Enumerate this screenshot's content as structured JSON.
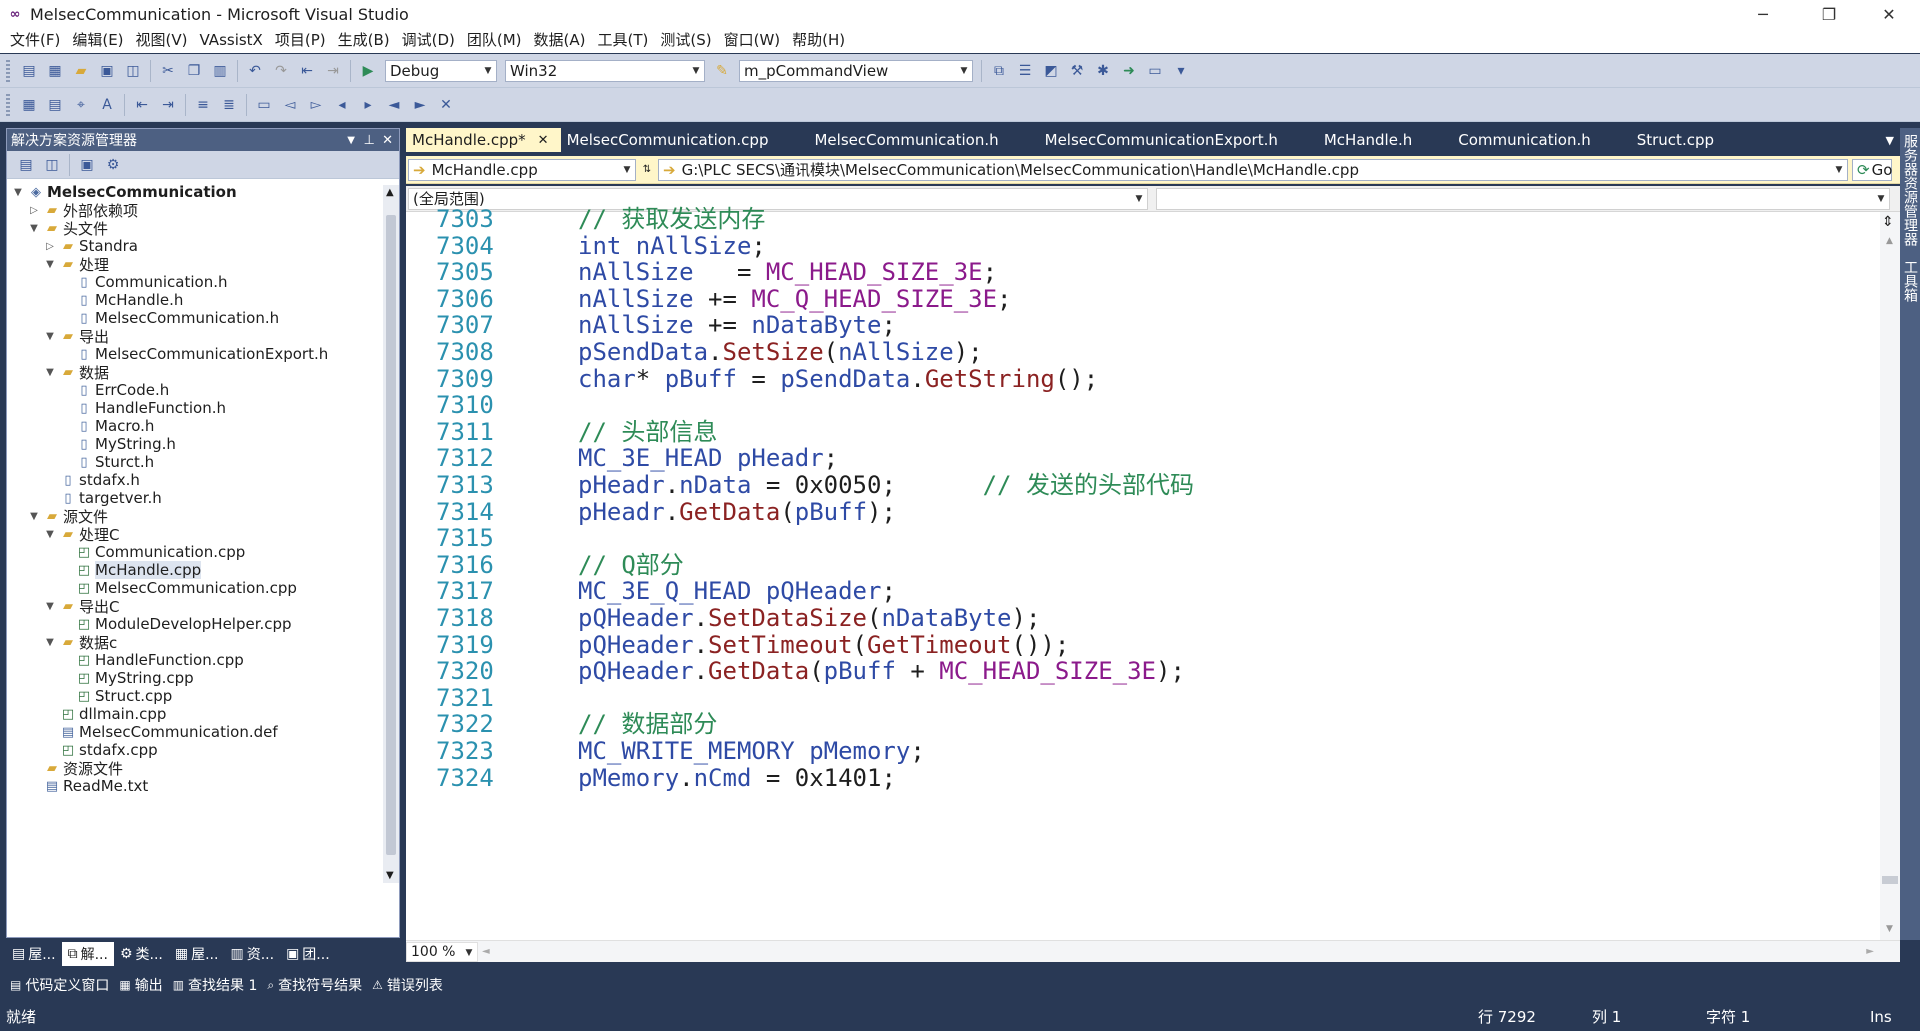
{
  "window": {
    "title": "MelsecCommunication - Microsoft Visual Studio",
    "minimize": "─",
    "maximize": "❐",
    "close": "✕"
  },
  "menu": [
    "文件(F)",
    "编辑(E)",
    "视图(V)",
    "VAssistX",
    "项目(P)",
    "生成(B)",
    "调试(D)",
    "团队(M)",
    "数据(A)",
    "工具(T)",
    "测试(S)",
    "窗口(W)",
    "帮助(H)"
  ],
  "toolbar": {
    "config": "Debug",
    "platform": "Win32",
    "find": "m_pCommandView"
  },
  "solution_explorer": {
    "title": "解决方案资源管理器",
    "tree": [
      {
        "label": "MelsecCommunication",
        "depth": 0,
        "exp": "▼",
        "icon": "solution",
        "bold": true
      },
      {
        "label": "外部依赖项",
        "depth": 1,
        "exp": "▷",
        "icon": "folder"
      },
      {
        "label": "头文件",
        "depth": 1,
        "exp": "▼",
        "icon": "folder"
      },
      {
        "label": "Standra",
        "depth": 2,
        "exp": "▷",
        "icon": "folder"
      },
      {
        "label": "处理",
        "depth": 2,
        "exp": "▼",
        "icon": "folder"
      },
      {
        "label": "Communication.h",
        "depth": 3,
        "exp": "",
        "icon": "h"
      },
      {
        "label": "McHandle.h",
        "depth": 3,
        "exp": "",
        "icon": "h"
      },
      {
        "label": "MelsecCommunication.h",
        "depth": 3,
        "exp": "",
        "icon": "h"
      },
      {
        "label": "导出",
        "depth": 2,
        "exp": "▼",
        "icon": "folder"
      },
      {
        "label": "MelsecCommunicationExport.h",
        "depth": 3,
        "exp": "",
        "icon": "h"
      },
      {
        "label": "数据",
        "depth": 2,
        "exp": "▼",
        "icon": "folder"
      },
      {
        "label": "ErrCode.h",
        "depth": 3,
        "exp": "",
        "icon": "h"
      },
      {
        "label": "HandleFunction.h",
        "depth": 3,
        "exp": "",
        "icon": "h"
      },
      {
        "label": "Macro.h",
        "depth": 3,
        "exp": "",
        "icon": "h"
      },
      {
        "label": "MyString.h",
        "depth": 3,
        "exp": "",
        "icon": "h"
      },
      {
        "label": "Sturct.h",
        "depth": 3,
        "exp": "",
        "icon": "h"
      },
      {
        "label": "stdafx.h",
        "depth": 2,
        "exp": "",
        "icon": "h"
      },
      {
        "label": "targetver.h",
        "depth": 2,
        "exp": "",
        "icon": "h"
      },
      {
        "label": "源文件",
        "depth": 1,
        "exp": "▼",
        "icon": "folder"
      },
      {
        "label": "处理C",
        "depth": 2,
        "exp": "▼",
        "icon": "folder"
      },
      {
        "label": "Communication.cpp",
        "depth": 3,
        "exp": "",
        "icon": "cpp"
      },
      {
        "label": "McHandle.cpp",
        "depth": 3,
        "exp": "",
        "icon": "cpp",
        "selected": true
      },
      {
        "label": "MelsecCommunication.cpp",
        "depth": 3,
        "exp": "",
        "icon": "cpp"
      },
      {
        "label": "导出C",
        "depth": 2,
        "exp": "▼",
        "icon": "folder"
      },
      {
        "label": "ModuleDevelopHelper.cpp",
        "depth": 3,
        "exp": "",
        "icon": "cpp"
      },
      {
        "label": "数据c",
        "depth": 2,
        "exp": "▼",
        "icon": "folder"
      },
      {
        "label": "HandleFunction.cpp",
        "depth": 3,
        "exp": "",
        "icon": "cpp"
      },
      {
        "label": "MyString.cpp",
        "depth": 3,
        "exp": "",
        "icon": "cpp"
      },
      {
        "label": "Struct.cpp",
        "depth": 3,
        "exp": "",
        "icon": "cpp"
      },
      {
        "label": "dllmain.cpp",
        "depth": 2,
        "exp": "",
        "icon": "cpp"
      },
      {
        "label": "MelsecCommunication.def",
        "depth": 2,
        "exp": "",
        "icon": "def"
      },
      {
        "label": "stdafx.cpp",
        "depth": 2,
        "exp": "",
        "icon": "cpp"
      },
      {
        "label": "资源文件",
        "depth": 1,
        "exp": "",
        "icon": "folder"
      },
      {
        "label": "ReadMe.txt",
        "depth": 1,
        "exp": "",
        "icon": "txt"
      }
    ],
    "bottom_tabs": [
      "屋...",
      "解...",
      "类...",
      "屋...",
      "资...",
      "团..."
    ]
  },
  "doc_tabs": [
    "McHandle.cpp*",
    "MelsecCommunication.cpp",
    "MelsecCommunication.h",
    "MelsecCommunicationExport.h",
    "McHandle.h",
    "Communication.h",
    "Struct.cpp"
  ],
  "nav": {
    "file": "McHandle.cpp",
    "path": "G:\\PLC SECS\\通讯模块\\MelsecCommunication\\MelsecCommunication\\Handle\\McHandle.cpp",
    "go": "Go",
    "scope": "(全局范围)"
  },
  "code": [
    {
      "ln": "7303",
      "parts": [
        [
          "cm",
          "// 获取发送内存"
        ]
      ]
    },
    {
      "ln": "7304",
      "parts": [
        [
          "kw",
          "int "
        ],
        [
          "kw",
          "nAllSize"
        ],
        [
          "pl",
          ";"
        ]
      ]
    },
    {
      "ln": "7305",
      "parts": [
        [
          "kw",
          "nAllSize  "
        ],
        [
          "pl",
          " = "
        ],
        [
          "mac",
          "MC_HEAD_SIZE_3E"
        ],
        [
          "pl",
          ";"
        ]
      ]
    },
    {
      "ln": "7306",
      "parts": [
        [
          "kw",
          "nAllSize "
        ],
        [
          "pl",
          "+= "
        ],
        [
          "mac",
          "MC_Q_HEAD_SIZE_3E"
        ],
        [
          "pl",
          ";"
        ]
      ]
    },
    {
      "ln": "7307",
      "parts": [
        [
          "kw",
          "nAllSize "
        ],
        [
          "pl",
          "+= "
        ],
        [
          "kw",
          "nDataByte"
        ],
        [
          "pl",
          ";"
        ]
      ]
    },
    {
      "ln": "7308",
      "parts": [
        [
          "kw",
          "pSendData"
        ],
        [
          "pl",
          "."
        ],
        [
          "fn",
          "SetSize"
        ],
        [
          "pl",
          "("
        ],
        [
          "kw",
          "nAllSize"
        ],
        [
          "pl",
          ");"
        ]
      ]
    },
    {
      "ln": "7309",
      "parts": [
        [
          "kw",
          "char"
        ],
        [
          "pl",
          "* "
        ],
        [
          "kw",
          "pBuff"
        ],
        [
          "pl",
          " = "
        ],
        [
          "kw",
          "pSendData"
        ],
        [
          "pl",
          "."
        ],
        [
          "fn",
          "GetString"
        ],
        [
          "pl",
          "();"
        ]
      ]
    },
    {
      "ln": "7310",
      "parts": []
    },
    {
      "ln": "7311",
      "parts": [
        [
          "cm",
          "// 头部信息"
        ]
      ]
    },
    {
      "ln": "7312",
      "parts": [
        [
          "kw",
          "MC_3E_HEAD "
        ],
        [
          "kw",
          "pHeadr"
        ],
        [
          "pl",
          ";"
        ]
      ]
    },
    {
      "ln": "7313",
      "parts": [
        [
          "kw",
          "pHeadr"
        ],
        [
          "pl",
          "."
        ],
        [
          "kw",
          "nData"
        ],
        [
          "pl",
          " = 0x0050;      "
        ],
        [
          "cm",
          "// 发送的头部代码"
        ]
      ]
    },
    {
      "ln": "7314",
      "parts": [
        [
          "kw",
          "pHeadr"
        ],
        [
          "pl",
          "."
        ],
        [
          "fn",
          "GetData"
        ],
        [
          "pl",
          "("
        ],
        [
          "kw",
          "pBuff"
        ],
        [
          "pl",
          ");"
        ]
      ]
    },
    {
      "ln": "7315",
      "parts": []
    },
    {
      "ln": "7316",
      "parts": [
        [
          "cm",
          "// Q部分"
        ]
      ]
    },
    {
      "ln": "7317",
      "parts": [
        [
          "kw",
          "MC_3E_Q_HEAD "
        ],
        [
          "kw",
          "pQHeader"
        ],
        [
          "pl",
          ";"
        ]
      ]
    },
    {
      "ln": "7318",
      "parts": [
        [
          "kw",
          "pQHeader"
        ],
        [
          "pl",
          "."
        ],
        [
          "fn",
          "SetDataSize"
        ],
        [
          "pl",
          "("
        ],
        [
          "kw",
          "nDataByte"
        ],
        [
          "pl",
          ");"
        ]
      ]
    },
    {
      "ln": "7319",
      "parts": [
        [
          "kw",
          "pQHeader"
        ],
        [
          "pl",
          "."
        ],
        [
          "fn",
          "SetTimeout"
        ],
        [
          "pl",
          "("
        ],
        [
          "fn",
          "GetTimeout"
        ],
        [
          "pl",
          "());"
        ]
      ]
    },
    {
      "ln": "7320",
      "parts": [
        [
          "kw",
          "pQHeader"
        ],
        [
          "pl",
          "."
        ],
        [
          "fn",
          "GetData"
        ],
        [
          "pl",
          "("
        ],
        [
          "kw",
          "pBuff"
        ],
        [
          "pl",
          " + "
        ],
        [
          "mac",
          "MC_HEAD_SIZE_3E"
        ],
        [
          "pl",
          ");"
        ]
      ]
    },
    {
      "ln": "7321",
      "parts": []
    },
    {
      "ln": "7322",
      "parts": [
        [
          "cm",
          "// 数据部分"
        ]
      ]
    },
    {
      "ln": "7323",
      "parts": [
        [
          "kw",
          "MC_WRITE_MEMORY "
        ],
        [
          "kw",
          "pMemory"
        ],
        [
          "pl",
          ";"
        ]
      ]
    },
    {
      "ln": "7324",
      "parts": [
        [
          "kw",
          "pMemory"
        ],
        [
          "pl",
          "."
        ],
        [
          "kw",
          "nCmd"
        ],
        [
          "pl",
          " = 0x1401;"
        ]
      ]
    }
  ],
  "zoom": "100 %",
  "right_strip": "服务器资源管理器",
  "right_strip2": "工具箱",
  "bottom_tabs": [
    "代码定义窗口",
    "输出",
    "查找结果 1",
    "查找符号结果",
    "错误列表"
  ],
  "status": {
    "ready": "就绪",
    "line": "行 7292",
    "col": "列 1",
    "char": "字符 1",
    "mode": "Ins"
  }
}
